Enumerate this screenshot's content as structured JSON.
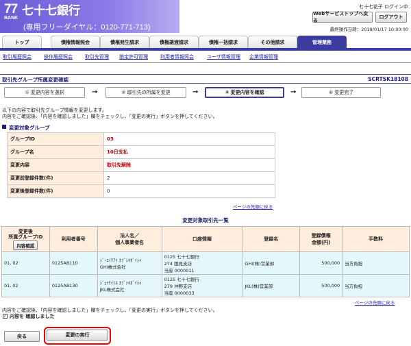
{
  "header": {
    "logo_number": "77",
    "logo_bank": "BANK",
    "bank_name": "七十七銀行",
    "hotline": "(専用フリーダイヤル：0120-771-713)",
    "user_status": "七十七花子 ログイン中",
    "top_button": "Webサービストップへ戻る",
    "logout_button": "ログアウト",
    "last_operation": "最終操作日時：2018/01/17 10:00:00"
  },
  "nav": {
    "tabs": [
      "トップ",
      "債権情報照会",
      "債権発生請求",
      "債権譲渡請求",
      "債権一括請求",
      "その他請求",
      "管理業務"
    ],
    "active_tab": "管理業務",
    "sublinks": [
      "取引履歴照会",
      "操作履歴照会",
      "取引先管理",
      "指定許可管理",
      "利用者情報照会",
      "ユーザ情報管理",
      "企業情報管理"
    ]
  },
  "page": {
    "title": "取引先グループ所属変更確認",
    "screen_id": "SCRTSK18108"
  },
  "steps": [
    "① 変更内容を選択",
    "② 取引先の所属を変更",
    "③ 変更内容を確認",
    "④ 変更完了"
  ],
  "active_step": 2,
  "instructions": {
    "line1": "以下の内容で取引先グループ情報を変更します。",
    "line2": "内容をご確認後、「内容を確認しました」欄をチェックし、「変更の実行」ボタンを押してください。"
  },
  "group_section": {
    "heading": "変更対象グループ",
    "rows": [
      {
        "label": "グループID",
        "value": "03"
      },
      {
        "label": "グループ名",
        "value": "10日支払"
      },
      {
        "label": "変更内容",
        "value": "取引先解除"
      },
      {
        "label": "変更前登録件数(件)",
        "value": "2"
      },
      {
        "label": "変更後登録件数(件)",
        "value": "0"
      }
    ],
    "pagetop": "ページの先頭に戻る"
  },
  "list_section": {
    "title": "変更対象取引先一覧",
    "headers": {
      "group": "変更後\n所属グループID",
      "group_btn": "内容確認",
      "user_no": "利用者番号",
      "corp": "法人名／\n個人事業者名",
      "account": "口座情報",
      "reg_name": "登録名",
      "limit": "登録債権\n金額(円)",
      "fee": "手数料"
    },
    "rows": [
      {
        "group": "01, 02",
        "user_no": "0125AB110",
        "corp_kana": "ｼﾞｰｴｲﾁｱｲ ｶﾌﾞｼｷｶﾞｲｼｬ",
        "corp": "GHI株式会社",
        "bank": "0125 七十七銀行",
        "branch": "274 国見支店",
        "account": "当座 0000011",
        "reg_name": "GHI(株)営業部",
        "limit": "500,000",
        "fee": "当方負担"
      },
      {
        "group": "01, 02",
        "user_no": "0125AB130",
        "corp_kana": "ｼﾞｪｲｹｲｴﾙ ｶﾌﾞｼｷｶﾞｲｼｬ",
        "corp": "JKL株式会社",
        "bank": "0125 七十七銀行",
        "branch": "279 沖野支店",
        "account": "当座 0000033",
        "reg_name": "JKL(株)営業部",
        "limit": "500,000",
        "fee": "当方負担"
      }
    ],
    "pagetop": "ページの先頭に戻る"
  },
  "confirm": {
    "instruction": "内容をご確認後、「内容を確認しました」欄をチェックし、「変更の実行」ボタンを押してください。",
    "checkbox_label": "内容を 確認しました",
    "checkbox_mark": "✓",
    "checked": true
  },
  "buttons": {
    "back": "戻る",
    "execute": "変更の実行"
  }
}
